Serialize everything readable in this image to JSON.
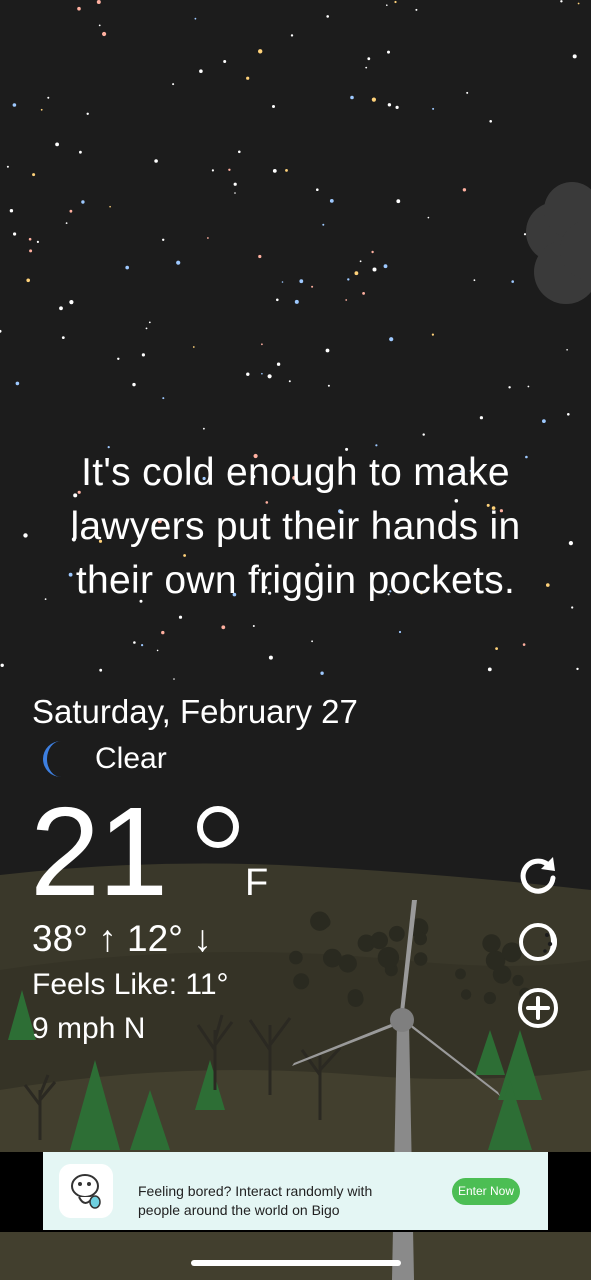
{
  "quote": [
    "It's cold enough to make",
    "lawyers put their hands in",
    "their own friggin pockets."
  ],
  "date": "Saturday, February 27",
  "condition": {
    "icon": "moon-icon",
    "text": "Clear"
  },
  "temperature": {
    "value": "21",
    "unit": "F"
  },
  "hilo": "38° ↑  12° ↓",
  "feels_like": "Feels Like: 11°",
  "wind": "9 mph N",
  "actions": [
    {
      "icon": "refresh-icon"
    },
    {
      "icon": "moon-phase-icon"
    },
    {
      "icon": "add-icon"
    }
  ],
  "ad": {
    "text": "Feeling bored? Interact randomly with people around the world on Bigo",
    "button": "Enter Now"
  },
  "colors": {
    "sky": "#1c1c1c",
    "hills": "#3c3a2a",
    "trees": "#2c6a34",
    "accent": "#4cbe54"
  }
}
